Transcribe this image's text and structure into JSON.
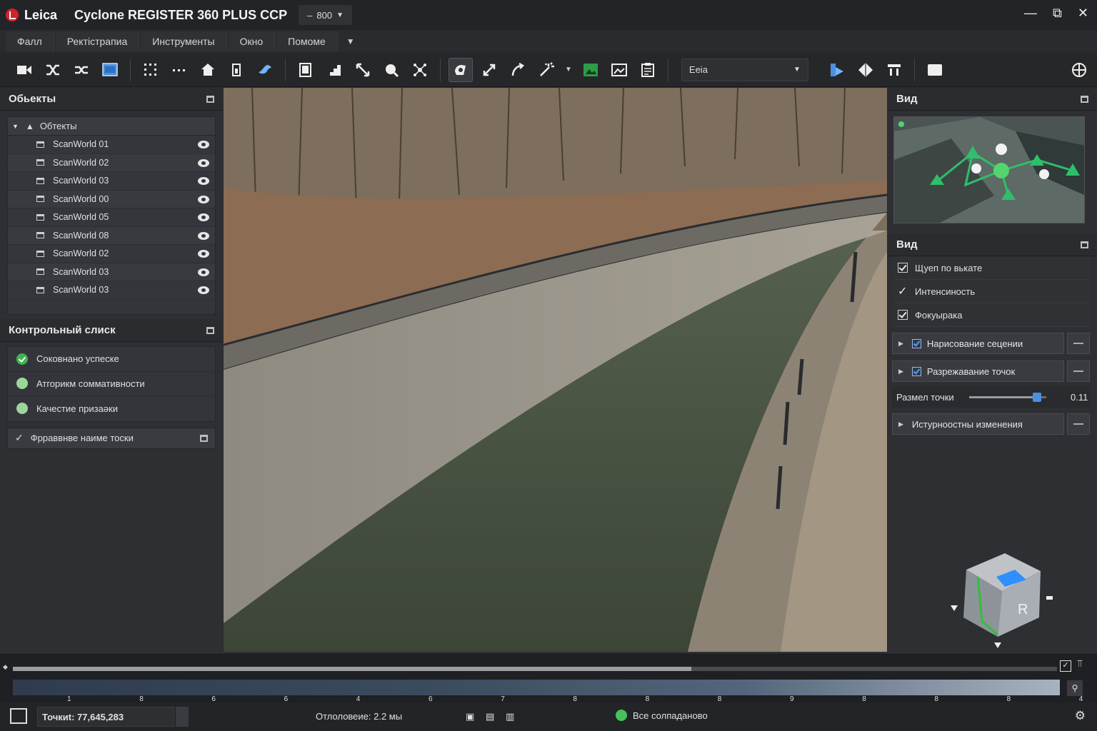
{
  "app": {
    "brand": "Leica",
    "title": "Cyclone REGISTER 360 PLUS CCP",
    "version": "800",
    "window_controls": [
      "minimize-icon",
      "restore-icon",
      "close-icon"
    ]
  },
  "menu": [
    "Фалл",
    "Ректістрапиа",
    "Инструменты",
    "Окно",
    "Помоме"
  ],
  "toolbar": {
    "icons": [
      "camera-icon",
      "shuffle-icon",
      "shuffle-alt-icon",
      "monitor-icon",
      "dots-grid-icon",
      "dots-line-icon",
      "home-icon",
      "cylinder-icon",
      "bird-icon",
      "page-icon",
      "stairs-icon",
      "arrows-icon",
      "globe-pin-icon",
      "network-icon",
      "rotate-icon",
      "expand-icon",
      "curve-arrow-icon",
      "wand-icon",
      "green-image-icon",
      "photo-icon",
      "clipboard-icon",
      "split-view-icon",
      "diamond-icon",
      "flag-icon",
      "rectangle-icon",
      "globe-settings-icon"
    ],
    "view_combo": "Eeia"
  },
  "objects_panel": {
    "title": "Обьекты",
    "root": "Обтекты",
    "items": [
      "ScanWorld 01",
      "ScanWorld 02",
      "ScanWorld 03",
      "ScanWorld 00",
      "ScanWorld 05",
      "ScanWorld 08",
      "ScanWorld 02",
      "ScanWorld 03",
      "ScanWorld 03"
    ]
  },
  "checklist_panel": {
    "title": "Контрольный слиск",
    "items": [
      {
        "label": "Соковнано успеске",
        "state": "done"
      },
      {
        "label": "Атгорикм соммативности",
        "state": "pending"
      },
      {
        "label": "Качестие призаәки",
        "state": "pending"
      }
    ],
    "refine": "Фрраввнве наиме тоски"
  },
  "view_panel": {
    "title": "Вид",
    "title2": "Вид",
    "options": [
      {
        "label": "Щуеп по вькате",
        "checked": true,
        "style": "box"
      },
      {
        "label": "Интенсиность",
        "checked": true,
        "style": "tick"
      },
      {
        "label": "Фокуырака",
        "checked": true,
        "style": "box"
      }
    ],
    "expanders": [
      "Нарисование сецении",
      "Разрежавание точок"
    ],
    "point_size": {
      "label": "Размел точки",
      "value": "0.11",
      "level": 0.88
    },
    "tools": "Истурноостны изменения"
  },
  "navcube": {
    "face": "R"
  },
  "timeline": {
    "progress": 0.65,
    "tick_labels": [
      "1",
      "8",
      "6",
      "6",
      "4",
      "6",
      "7",
      "8",
      "8",
      "8",
      "9",
      "8",
      "8",
      "8",
      "4"
    ]
  },
  "status": {
    "points": "Точкиt: 77,645,283",
    "deviation": "Отлоловеие: 2.2 мы",
    "state": "Все солпаданово"
  },
  "colors": {
    "accent": "#4a8fe0",
    "ok": "#49c15a",
    "brand": "#d2232a"
  }
}
